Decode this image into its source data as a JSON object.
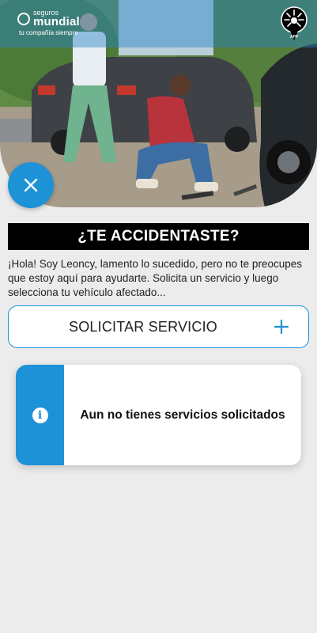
{
  "header": {
    "brand_small": "seguros",
    "brand_name": "mundial",
    "brand_tagline": "tu compañía siempre",
    "app_badge": "APP"
  },
  "page": {
    "title": "¿TE ACCIDENTASTE?",
    "intro": "¡Hola! Soy Leoncy, lamento lo sucedido, pero no te preocupes que estoy aquí para ayudarte. Solicita un servicio y luego selecciona tu vehículo afectado..."
  },
  "actions": {
    "request_service_label": "SOLICITAR SERVICIO"
  },
  "services": {
    "empty_message": "Aun no tienes servicios solicitados"
  },
  "icons": {
    "close": "close-icon",
    "plus": "plus-icon",
    "info": "info-icon"
  },
  "colors": {
    "accent": "#1d92d6",
    "title_bg": "#000000",
    "background": "#ececec"
  }
}
